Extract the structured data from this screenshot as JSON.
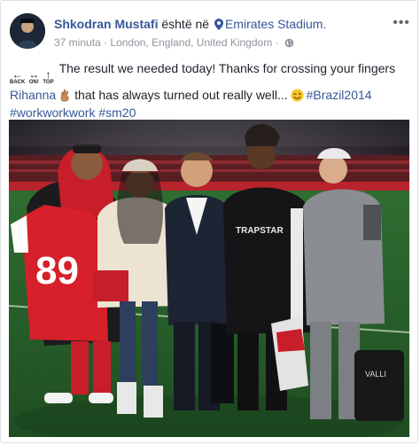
{
  "post": {
    "author": "Shkodran Mustafi",
    "location_prefix": "është në",
    "location": "Emirates Stadium.",
    "time": "37 minuta",
    "separator": "·",
    "place": "London, England, United Kingdom",
    "emoji_row": {
      "back": "BACK",
      "on": "ON!",
      "top": "TOP"
    },
    "text_main": "The result we needed today! Thanks for crossing your fingers",
    "mention": "Rihanna",
    "text_after_mention": "that has always turned out really well...",
    "hashtags": [
      "#Brazil2014",
      "#workworkwork",
      "#sm20"
    ],
    "icons": [
      "user-avatar",
      "location-pin-icon",
      "globe-icon",
      "more-options-icon",
      "crossed-fingers-emoji",
      "wink-emoji"
    ]
  },
  "photo": {
    "jersey_number": "89",
    "shirt_brand": "TRAPSTAR",
    "bag_brand": "VALLI"
  },
  "colors": {
    "link": "#365899",
    "meta": "#90949c",
    "text": "#1d2129",
    "pitch": "#2d6b2e",
    "arsenal_red": "#d6202a"
  }
}
